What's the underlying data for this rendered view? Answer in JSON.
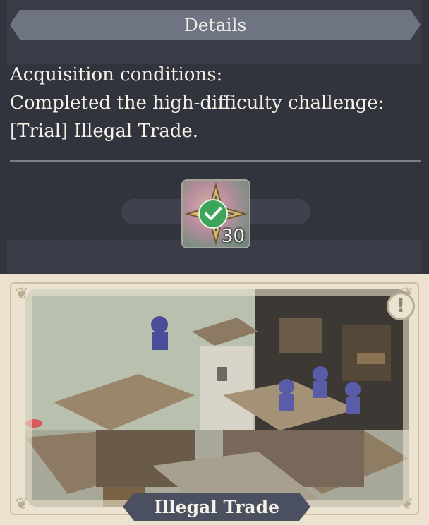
{
  "details": {
    "header": "Details",
    "conditions_lines": [
      "Acquisition conditions:",
      "Completed the high-difficulty challenge:",
      "[Trial] Illegal Trade."
    ],
    "reward": {
      "count": "30",
      "icon": "compass-star-icon",
      "status_icon": "checkmark-icon"
    }
  },
  "stage": {
    "name": "Illegal Trade",
    "info_icon": "exclamation-icon"
  },
  "colors": {
    "panel": "#3a3d48",
    "header_pill": "#6f7482",
    "card_bg": "#ebe3cf",
    "name_pill": "#4a5060",
    "check_green": "#3da55a"
  }
}
